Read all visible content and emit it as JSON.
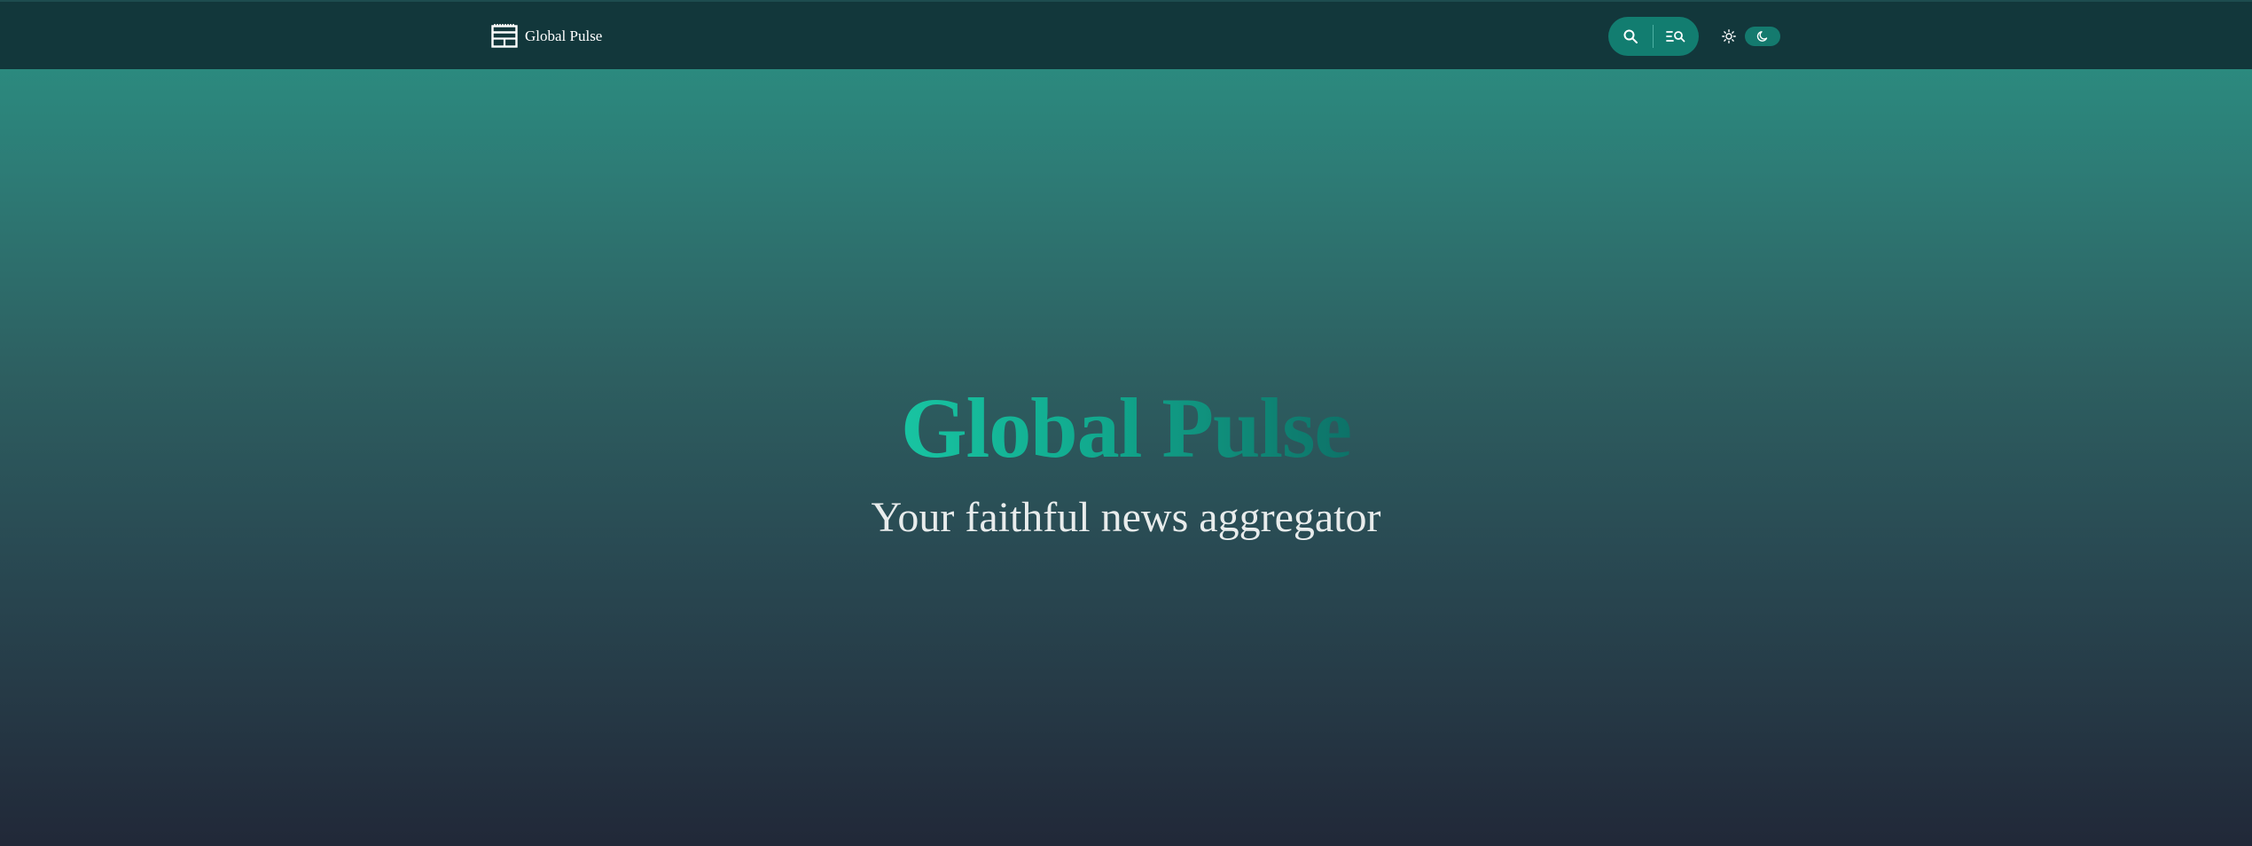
{
  "navbar": {
    "brand": {
      "icon": "newspaper-icon",
      "label": "Global Pulse"
    },
    "search": {
      "search_icon": "search-icon",
      "advanced_search_icon": "list-search-icon"
    },
    "theme": {
      "light_icon": "sun-icon",
      "dark_icon": "moon-icon",
      "active": "dark"
    }
  },
  "hero": {
    "title": "Global Pulse",
    "subtitle": "Your faithful news aggregator"
  },
  "colors": {
    "navbar_bg": "#12373b",
    "accent": "#127d70",
    "title_gradient_start": "#18c4a2",
    "title_gradient_end": "#0d7268",
    "subtitle": "#e8ecec"
  }
}
